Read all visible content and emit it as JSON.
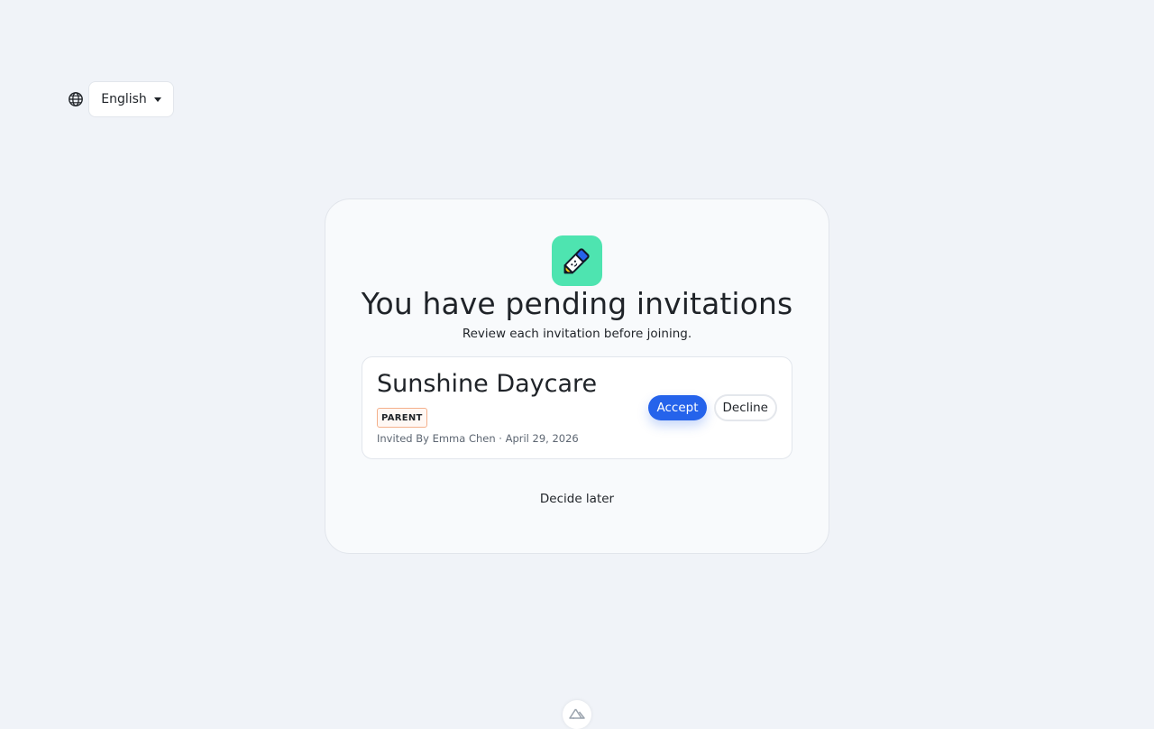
{
  "language_switcher": {
    "icon": "globe-icon",
    "selected": "English"
  },
  "card": {
    "logo_icon": "pencil-icon",
    "title": "You have pending invitations",
    "subtitle": "Review each invitation before joining.",
    "invitations": [
      {
        "organization": "Sunshine Daycare",
        "role": "PARENT",
        "invited_by": "Invited By Emma Chen · April 29, 2026",
        "accept_label": "Accept",
        "decline_label": "Decline"
      }
    ],
    "decide_later_label": "Decide later"
  },
  "footer": {
    "icon": "nuxt-logo-icon"
  },
  "colors": {
    "background": "#f0f3f8",
    "accent": "#2563eb",
    "logo_bg": "#4ee4b0",
    "badge_border": "#f4b08b"
  }
}
